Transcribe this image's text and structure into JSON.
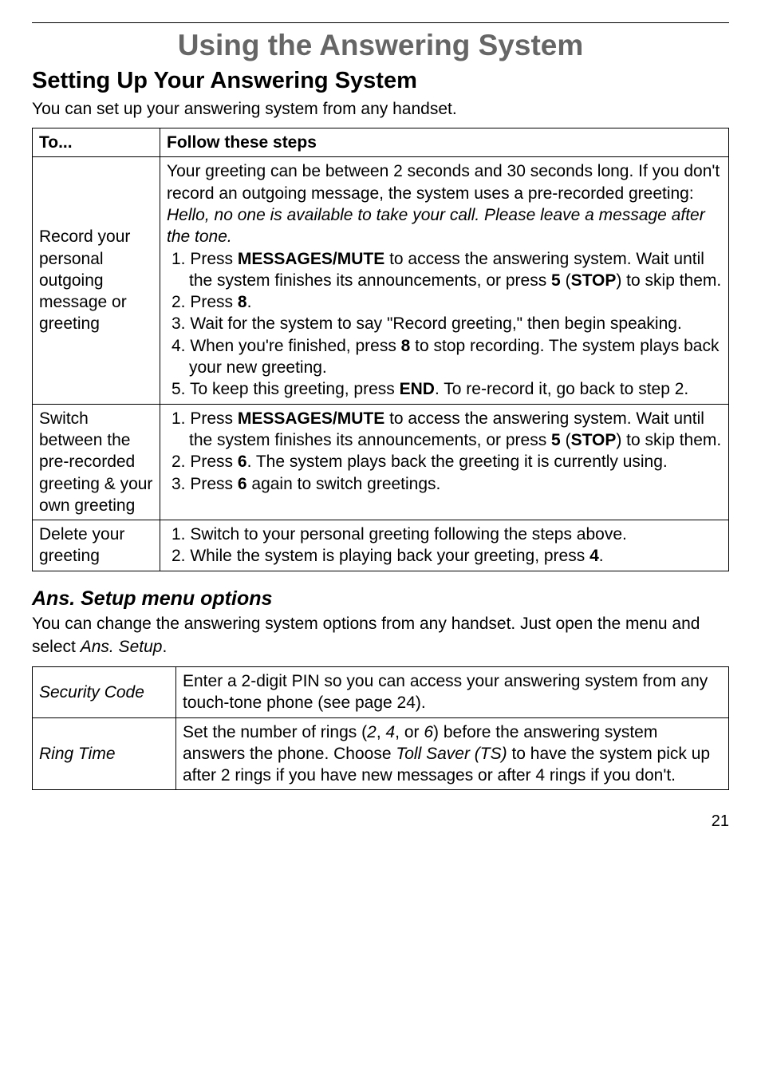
{
  "page_title": "Using the Answering System",
  "section_heading": "Setting Up Your Answering System",
  "intro": "You can set up your answering system from any handset.",
  "table1": {
    "headers": {
      "to": "To...",
      "steps": "Follow these steps"
    },
    "rows": [
      {
        "label": "Record your personal outgoing message or greeting",
        "pre1": "Your greeting can be between 2 seconds and 30 seconds long. If you don't record an outgoing message, the system uses a pre-recorded greeting: ",
        "pre_italic": "Hello, no one is available to take your call. Please leave a message after the tone.",
        "s1a": "1. Press ",
        "s1b": "MESSAGES/MUTE",
        "s1c": " to access the answering system. Wait until the system finishes its announcements, or press ",
        "s1d": "5",
        "s1e": " (",
        "s1f": "STOP",
        "s1g": ") to skip them.",
        "s2a": "2. Press ",
        "s2b": "8",
        "s2c": ".",
        "s3": "3. Wait for the system to say \"Record greeting,\" then begin speaking.",
        "s4a": "4. When you're finished, press ",
        "s4b": "8",
        "s4c": " to stop recording. The system plays back your new greeting.",
        "s5a": "5. To keep this greeting, press ",
        "s5b": "END",
        "s5c": ". To re-record it, go back to step 2."
      },
      {
        "label": "Switch between the pre-recorded greeting & your own greeting",
        "s1a": "1. Press ",
        "s1b": "MESSAGES/MUTE",
        "s1c": " to access the answering system. Wait until the system finishes its announcements, or press ",
        "s1d": "5",
        "s1e": " (",
        "s1f": "STOP",
        "s1g": ") to skip them.",
        "s2a": "2. Press ",
        "s2b": "6",
        "s2c": ". The system plays back the greeting it is currently using.",
        "s3a": "3. Press ",
        "s3b": "6",
        "s3c": " again to switch greetings."
      },
      {
        "label": "Delete your greeting",
        "s1": "1. Switch to your personal greeting following the steps above.",
        "s2a": "2. While the system is playing back your greeting, press ",
        "s2b": "4",
        "s2c": "."
      }
    ]
  },
  "sub_heading": "Ans. Setup menu options",
  "sub_intro_a": "You can change the answering system options from any handset. Just open the menu and select ",
  "sub_intro_b": "Ans. Setup",
  "sub_intro_c": ".",
  "table2": {
    "rows": [
      {
        "label": "Security Code",
        "desc": "Enter a 2-digit PIN so you can access your answering system from any touch-tone phone (see page 24)."
      },
      {
        "label": "Ring Time",
        "d1": "Set the number of rings (",
        "d2": "2",
        "d3": ", ",
        "d4": "4",
        "d5": ", or ",
        "d6": "6",
        "d7": ") before the answering system answers the phone. Choose ",
        "d8": "Toll Saver (TS)",
        "d9": " to have the system pick up after 2 rings if you have new messages or after 4 rings if you don't."
      }
    ]
  },
  "page_number": "21"
}
